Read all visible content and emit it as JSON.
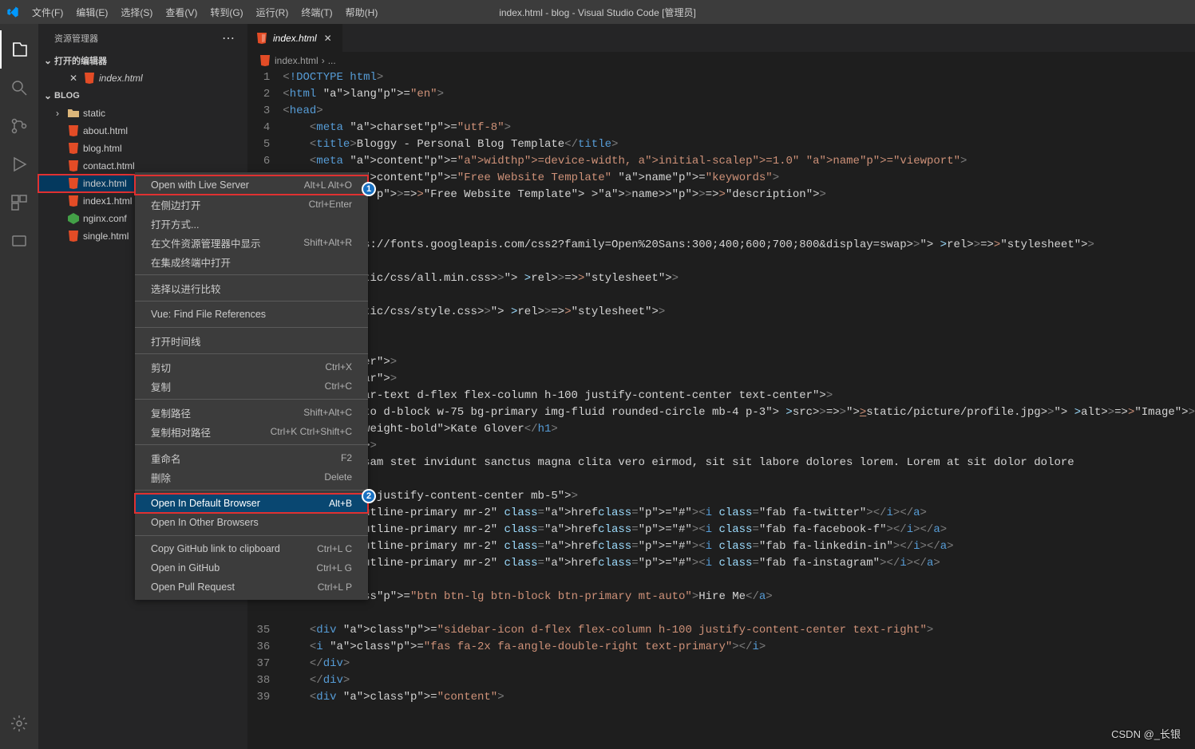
{
  "window_title": "index.html - blog - Visual Studio Code [管理员]",
  "menubar": [
    "文件(F)",
    "编辑(E)",
    "选择(S)",
    "查看(V)",
    "转到(G)",
    "运行(R)",
    "终端(T)",
    "帮助(H)"
  ],
  "sidebar": {
    "title": "资源管理器",
    "open_editors_label": "打开的编辑器",
    "open_editors": [
      {
        "name": "index.html",
        "dirty": true
      }
    ],
    "workspace_label": "BLOG",
    "tree": [
      {
        "name": "static",
        "type": "folder"
      },
      {
        "name": "about.html",
        "type": "html"
      },
      {
        "name": "blog.html",
        "type": "html"
      },
      {
        "name": "contact.html",
        "type": "html"
      },
      {
        "name": "index.html",
        "type": "html",
        "selected": true
      },
      {
        "name": "index1.html",
        "type": "html"
      },
      {
        "name": "nginx.conf",
        "type": "nginx"
      },
      {
        "name": "single.html",
        "type": "html"
      }
    ]
  },
  "tab": {
    "name": "index.html"
  },
  "breadcrumbs": {
    "file": "index.html",
    "more": "..."
  },
  "code_lines": [
    {
      "n": 1,
      "indent": 0,
      "raw": "<!DOCTYPE html>"
    },
    {
      "n": 2,
      "indent": 0,
      "raw": "<html lang=\"en\">"
    },
    {
      "n": 3,
      "indent": 0,
      "raw": "<head>"
    },
    {
      "n": 4,
      "indent": 1,
      "raw": "<meta charset=\"utf-8\">"
    },
    {
      "n": 5,
      "indent": 1,
      "raw": "<title>Bloggy - Personal Blog Template</title>"
    },
    {
      "n": 6,
      "indent": 1,
      "raw": "<meta content=\"width=device-width, initial-scale=1.0\" name=\"viewport\">"
    },
    {
      "n": 7,
      "indent": 1,
      "raw": "<meta content=\"Free Website Template\" name=\"keywords\">"
    },
    {
      "n": "",
      "indent": 1,
      "raw_partial": "t=\"Free Website Template\" name=\"description\">"
    },
    {
      "n": "",
      "indent": 1,
      "raw": ""
    },
    {
      "n": "",
      "indent": 1,
      "raw": ""
    },
    {
      "n": "",
      "indent": 1,
      "raw_partial_link": "\"https://fonts.googleapis.com/css2?family=Open%20Sans:300;400;600;700;800&display=swap\" rel=\"stylesheet\">"
    },
    {
      "n": "",
      "indent": 1,
      "raw": ""
    },
    {
      "n": "",
      "indent": 1,
      "raw_partial_link2": "\"static/css/all.min.css\" rel=\"stylesheet\">"
    },
    {
      "n": "",
      "indent": 1,
      "raw": ""
    },
    {
      "n": "",
      "indent": 1,
      "raw_partial_link2": "\"static/css/style.css\" rel=\"stylesheet\">"
    },
    {
      "n": "",
      "indent": 1,
      "raw": ""
    },
    {
      "n": "",
      "indent": 1,
      "raw": ""
    },
    {
      "n": "",
      "indent": 1,
      "raw_partial_attr": "\"wrapper\">"
    },
    {
      "n": "",
      "indent": 1,
      "raw_partial_attr": "\"sidebar\">"
    },
    {
      "n": "",
      "indent": 1,
      "raw_partial_attr": "\"sidebar-text d-flex flex-column h-100 justify-content-center text-center\">"
    },
    {
      "n": "",
      "indent": 1,
      "raw_partial_img": "\"mx-auto d-block w-75 bg-primary img-fluid rounded-circle mb-4 p-3\" src=\"static/picture/profile.jpg\" alt=\"Image\">"
    },
    {
      "n": "",
      "indent": 1,
      "raw_partial_h1": "\"font-weight-bold\">Kate Glover</h1>"
    },
    {
      "n": "",
      "indent": 1,
      "raw_partial_attr": "\"mb-4\">"
    },
    {
      "n": "",
      "indent": 1,
      "raw_text": " no accusam stet invidunt sanctus magna clita vero eirmod, sit sit labore dolores lorem. Lorem at sit dolor dolore"
    },
    {
      "n": "",
      "indent": 1,
      "raw": ""
    },
    {
      "n": "",
      "indent": 1,
      "raw_partial_attr": "\"d-flex justify-content-center mb-5\">"
    },
    {
      "n": "",
      "indent": 1,
      "raw_social": "tn btn-outline-primary mr-2\" href=\"#\"><i class=\"fab fa-twitter\"></i></a>"
    },
    {
      "n": "",
      "indent": 1,
      "raw_social": "tn btn-outline-primary mr-2\" href=\"#\"><i class=\"fab fa-facebook-f\"></i></a>"
    },
    {
      "n": "",
      "indent": 1,
      "raw_social": "tn btn-outline-primary mr-2\" href=\"#\"><i class=\"fab fa-linkedin-in\"></i></a>"
    },
    {
      "n": "",
      "indent": 1,
      "raw_social": "tn btn-outline-primary mr-2\" href=\"#\"><i class=\"fab fa-instagram\"></i></a>"
    },
    {
      "n": "",
      "indent": 1,
      "raw": ""
    },
    {
      "n": "",
      "indent": 1,
      "raw_hire": " class=\"btn btn-lg btn-block btn-primary mt-auto\">Hire Me</a>"
    },
    {
      "n": "",
      "indent": 1,
      "raw": ""
    },
    {
      "n": 35,
      "indent": 1,
      "raw": "<div class=\"sidebar-icon d-flex flex-column h-100 justify-content-center text-right\">"
    },
    {
      "n": 36,
      "indent": 1,
      "raw": "<i class=\"fas fa-2x fa-angle-double-right text-primary\"></i>"
    },
    {
      "n": 37,
      "indent": 1,
      "raw": "</div>"
    },
    {
      "n": 38,
      "indent": 1,
      "raw": "</div>"
    },
    {
      "n": 39,
      "indent": 1,
      "raw": "<div class=\"content\">"
    }
  ],
  "context_menu": {
    "groups": [
      [
        {
          "label": "Open with Live Server",
          "shortcut": "Alt+L Alt+O",
          "highlight": true,
          "badge": 1
        },
        {
          "label": "在侧边打开",
          "shortcut": "Ctrl+Enter"
        },
        {
          "label": "打开方式...",
          "shortcut": ""
        },
        {
          "label": "在文件资源管理器中显示",
          "shortcut": "Shift+Alt+R"
        },
        {
          "label": "在集成终端中打开",
          "shortcut": ""
        }
      ],
      [
        {
          "label": "选择以进行比较",
          "shortcut": ""
        }
      ],
      [
        {
          "label": "Vue: Find File References",
          "shortcut": ""
        }
      ],
      [
        {
          "label": "打开时间线",
          "shortcut": ""
        }
      ],
      [
        {
          "label": "剪切",
          "shortcut": "Ctrl+X"
        },
        {
          "label": "复制",
          "shortcut": "Ctrl+C"
        }
      ],
      [
        {
          "label": "复制路径",
          "shortcut": "Shift+Alt+C"
        },
        {
          "label": "复制相对路径",
          "shortcut": "Ctrl+K Ctrl+Shift+C"
        }
      ],
      [
        {
          "label": "重命名",
          "shortcut": "F2"
        },
        {
          "label": "删除",
          "shortcut": "Delete"
        }
      ],
      [
        {
          "label": "Open In Default Browser",
          "shortcut": "Alt+B",
          "highlight": true,
          "hovered": true,
          "badge": 2
        },
        {
          "label": "Open In Other Browsers",
          "shortcut": ""
        }
      ],
      [
        {
          "label": "Copy GitHub link to clipboard",
          "shortcut": "Ctrl+L C"
        },
        {
          "label": "Open in GitHub",
          "shortcut": "Ctrl+L G"
        },
        {
          "label": "Open Pull Request",
          "shortcut": "Ctrl+L P"
        }
      ]
    ]
  },
  "watermark": "CSDN @_长银"
}
